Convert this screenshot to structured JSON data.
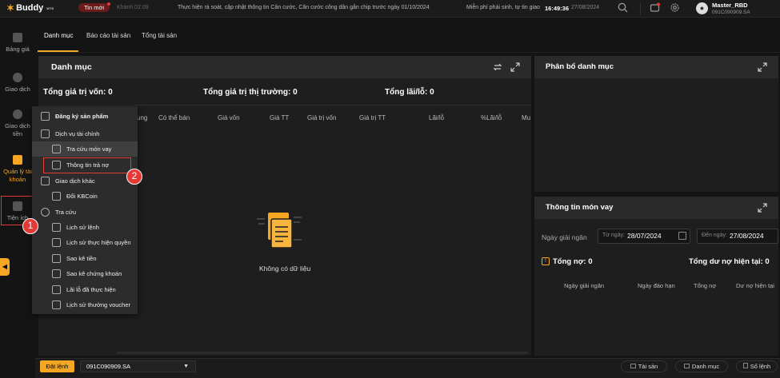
{
  "header": {
    "logo_text": "Buddy",
    "logo_sup": "WTS",
    "news_label": "Tin mới",
    "ticker_1": "Khánh 02.09",
    "ticker_2": "Thực hiện rà soát, cập nhật thông tin Căn cước, Căn cước công dân gắn chip trước ngày 01/10/2024",
    "ticker_3": "Miễn phí phái sinh, tự tin giao",
    "time": "16:49:36",
    "date": "27/08/2024",
    "user_name": "Master_RBD",
    "account_id": "091C090909.SA"
  },
  "sidebar": {
    "items": [
      {
        "label": "Bảng giá"
      },
      {
        "label": "Giao dịch"
      },
      {
        "label": "Giao dịch tiền"
      },
      {
        "label": "Quản lý tài khoản"
      },
      {
        "label": "Tiện ích"
      }
    ]
  },
  "tabs": [
    {
      "label": "Danh mục"
    },
    {
      "label": "Báo cáo tài sản"
    },
    {
      "label": "Tổng tài sản"
    }
  ],
  "portfolio": {
    "title": "Danh mục",
    "total_cost": "Tổng giá trị vốn: 0",
    "total_market": "Tổng giá trị thị trường: 0",
    "total_pl": "Tổng lãi/lỗ: 0",
    "columns": [
      "ung",
      "Có thể bán",
      "Giá vốn",
      "Giá TT",
      "Giá trị vốn",
      "Giá trị TT",
      "Lãi/lỗ",
      "%Lãi/lỗ",
      "Mu"
    ],
    "empty_text": "Không có dữ liệu"
  },
  "allocation": {
    "title": "Phân bổ danh mục"
  },
  "loan": {
    "title": "Thông tin món vay",
    "date_label": "Ngày giải ngân",
    "from_label": "Từ ngày:",
    "from_value": "28/07/2024",
    "to_label": "Đến ngày:",
    "to_value": "27/08/2024",
    "total_debt": "Tổng nợ: 0",
    "total_outstanding": "Tổng dư nợ hiện tại: 0",
    "columns": [
      "Ngày giải ngân",
      "Ngày đáo hạn",
      "Tổng nợ",
      "Dư nợ hiện tại"
    ]
  },
  "menu": {
    "items": [
      {
        "label": "Đăng ký sản phẩm"
      },
      {
        "label": "Dịch vụ tài chính"
      },
      {
        "label": "Tra cứu món vay"
      },
      {
        "label": "Thông tin trả nợ"
      },
      {
        "label": "Giao dịch khác"
      },
      {
        "label": "Đổi KBCoin"
      },
      {
        "label": "Tra cứu"
      },
      {
        "label": "Lịch sử lệnh"
      },
      {
        "label": "Lịch sử thực hiện quyền"
      },
      {
        "label": "Sao kê tiền"
      },
      {
        "label": "Sao kê chứng khoán"
      },
      {
        "label": "Lãi lỗ đã thực hiện"
      },
      {
        "label": "Lịch sử thưởng voucher"
      }
    ]
  },
  "annotations": {
    "badge_1": "1",
    "badge_2": "2"
  },
  "footer": {
    "order_button": "Đặt lệnh",
    "account_select": "091C090909.SA",
    "assets_button": "Tài sản",
    "portfolio_button": "Danh mục",
    "orderbook_button": "Sổ lệnh"
  },
  "colors": {
    "accent": "#f5a623",
    "highlight_red": "#e53935",
    "background": "#141414",
    "panel_header": "#2a2a2a"
  }
}
